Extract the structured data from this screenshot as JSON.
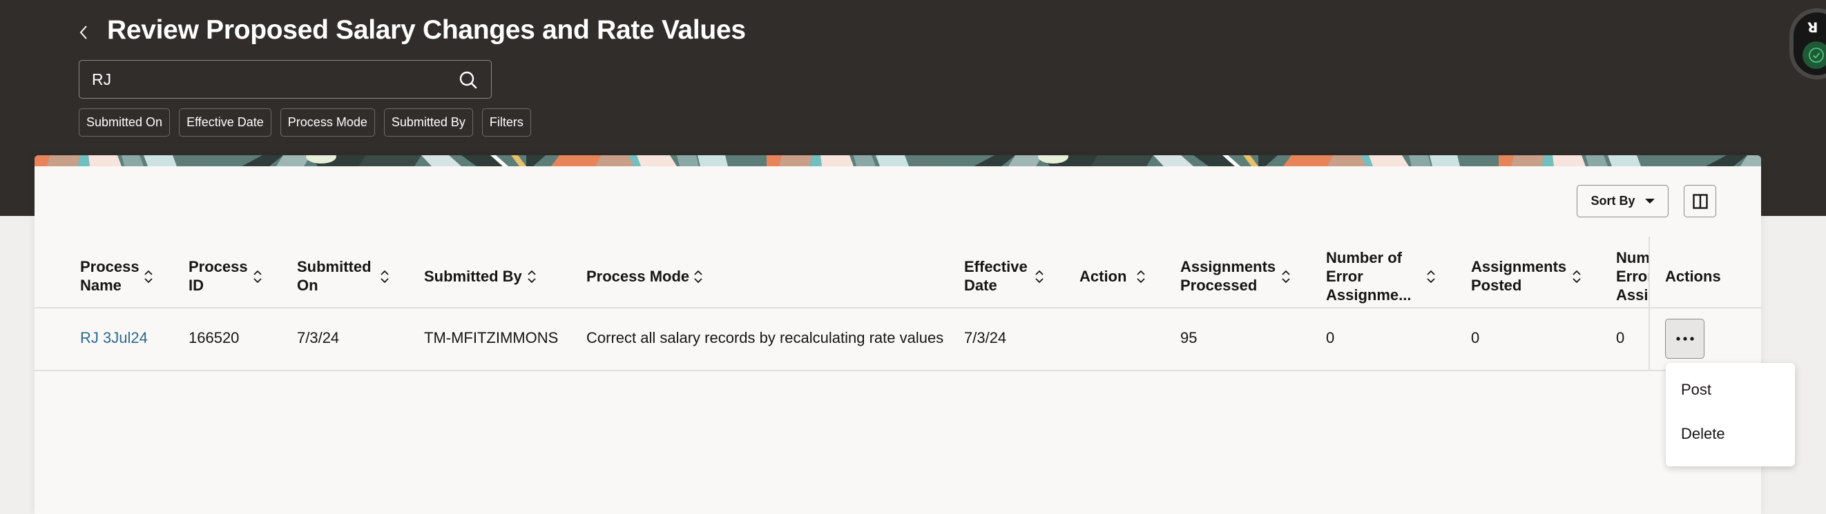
{
  "header": {
    "title": "Review Proposed Salary Changes and Rate Values",
    "back_icon": "chevron-left-icon"
  },
  "search": {
    "value": "RJ",
    "placeholder": "",
    "icon": "search-icon"
  },
  "filter_chips": [
    "Submitted On",
    "Effective Date",
    "Process Mode",
    "Submitted By",
    "Filters"
  ],
  "toolbar": {
    "sort_by_label": "Sort By",
    "column_toggle_icon": "columns-icon"
  },
  "table": {
    "columns": [
      {
        "label": "Process\nName",
        "sortable": true
      },
      {
        "label": "Process\nID",
        "sortable": true
      },
      {
        "label": "Submitted\nOn",
        "sortable": true
      },
      {
        "label": "Submitted By",
        "sortable": true
      },
      {
        "label": "Process Mode",
        "sortable": true
      },
      {
        "label": "Effective\nDate",
        "sortable": true
      },
      {
        "label": "Action",
        "sortable": true
      },
      {
        "label": "Assignments\nProcessed",
        "sortable": true
      },
      {
        "label": "Number of\nError\nAssignme...",
        "sortable": true
      },
      {
        "label": "Assignments\nPosted",
        "sortable": true
      },
      {
        "label": "Num\nError\nAssig",
        "sortable": false
      },
      {
        "label": "Actions",
        "sortable": false
      }
    ],
    "rows": [
      {
        "process_name": "RJ 3Jul24",
        "process_id": "166520",
        "submitted_on": "7/3/24",
        "submitted_by": "TM-MFITZIMMONS",
        "process_mode": "Correct all salary records by recalculating rate values",
        "effective_date": "7/3/24",
        "action": "",
        "assignments_processed": "95",
        "number_of_error_assignments": "0",
        "assignments_posted": "0",
        "number_of_error_assignments_posted": "0"
      }
    ]
  },
  "actions_menu": {
    "items": [
      "Post",
      "Delete"
    ]
  },
  "colors": {
    "header_bg": "#312d2a",
    "card_bg": "#f9f8f6",
    "link": "#2a6a8f",
    "status_green": "#1f5a36"
  }
}
